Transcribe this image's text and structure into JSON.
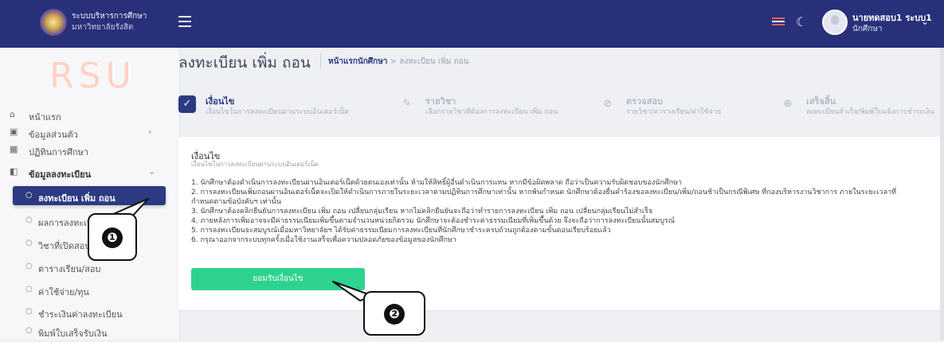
{
  "topbar": {
    "brand_line1": "ระบบบริหารการศึกษา",
    "brand_line2": "มหาวิทยาลัยรังสิต",
    "user_name": "นายทดสอบ1 ระบบ1",
    "user_role": "นักศึกษา"
  },
  "sidebar": {
    "logo_text": "RSU",
    "items": [
      {
        "label": "หน้าแรก",
        "icon": "home-icon"
      },
      {
        "label": "ข้อมูลส่วนตัว",
        "icon": "id-card-icon"
      },
      {
        "label": "ปฏิทินการศึกษา",
        "icon": "calendar-icon"
      },
      {
        "label": "ข้อมูลลงทะเบียน",
        "icon": "register-icon"
      }
    ],
    "sub_items": [
      {
        "label": "ลงทะเบียน เพิ่ม ถอน"
      },
      {
        "label": "ผลการลงทะเบียน"
      },
      {
        "label": "วิชาที่เปิดสอน"
      },
      {
        "label": "ตารางเรียน/สอบ"
      },
      {
        "label": "ค่าใช้จ่าย/ทุน"
      },
      {
        "label": "ชำระเงินค่าลงทะเบียน"
      },
      {
        "label": "พิมพ์ใบเสร็จรับเงิน"
      }
    ]
  },
  "header": {
    "page_title": "ลงทะเบียน เพิ่ม ถอน",
    "breadcrumb_home": "หน้าแรกนักศึกษา",
    "breadcrumb_sep": ">",
    "breadcrumb_current": "ลงทะเบียน เพิ่ม ถอน"
  },
  "steps": [
    {
      "title": "เงื่อนไข",
      "subtitle": "เงื่อนไขในการลงทะเบียนผ่านระบบอินเตอร์เน็ต",
      "icon": "check-icon",
      "active": true
    },
    {
      "title": "รายวิชา",
      "subtitle": "เลือกรายวิชาที่ต้องการลงทะเบียน เพิ่ม ถอน",
      "icon": "edit-icon",
      "active": false
    },
    {
      "title": "ตรวจสอบ",
      "subtitle": "รายวิชา/ตารางเรียน/ค่าใช้จ่าย",
      "icon": "check-circle-icon",
      "active": false
    },
    {
      "title": "เสร็จสิ้น",
      "subtitle": "ลงทะเบียนสำเร็จ/พิมพ์ใบแจ้งการชำระเงิน",
      "icon": "globe-icon",
      "active": false
    }
  ],
  "card": {
    "title": "เงื่อนไข",
    "subtitle": "เงื่อนไขในการลงทะเบียนผ่านระบบอินเตอร์เน็ต",
    "lines": [
      "1. นักศึกษาต้องดำเนินการลงทะเบียนผ่านอินเตอร์เน็ตด้วยตนเองเท่านั้น ห้ามให้สิทธิ์ผู้อื่นดำเนินการแทน หากมีข้อผิดพลาด ถือว่าเป็นความรับผิดชอบของนักศึกษา",
      "2. การลงทะเบียนเพิ่มถอนผ่านอินเตอร์เน็ตจะเปิดให้ดำเนินการภายในระยะเวลาตามปฏิทินการศึกษาเท่านั้น หากพ้นกำหนด นักศึกษาต้องยื่นคำร้องขอลงทะเบียน/เพิ่ม/ถอนช้าเป็นกรณีพิเศษ ที่กองบริหารงานวิชาการ ภายในระยะเวลาที่",
      "กำหนดตามข้อบังคับฯ เท่านั้น",
      "3. นักศึกษาต้องคลิกยืนยันการลงทะเบียน เพิ่ม ถอน เปลี่ยนกลุ่มเรียน หากไม่คลิกยืนยันจะถือว่าทำรายการลงทะเบียน เพิ่ม ถอน เปลี่ยนกลุ่มเรียนไม่สำเร็จ",
      "4. ภายหลังการเพิ่มอาจจะมีค่าธรรมเนียมเพิ่มขึ้นตามจำนวนหน่วยกิตรวม นักศึกษาจะต้องชำระค่าธรรมเนียมที่เพิ่มขึ้นด้วย จึงจะถือว่าการลงทะเบียนนั้นสมบูรณ์",
      "5. การลงทะเบียนจะสมบูรณ์เมื่อมหาวิทยาลัยฯ ได้รับค่าธรรมเนียมการลงทะเบียนที่นักศึกษาชำระครบถ้วนถูกต้องตามขั้นตอนเรียบร้อยแล้ว",
      "6. กรุณาออกจากระบบทุกครั้งเมื่อใช้งานเสร็จเพื่อความปลอดภัยของข้อมูลของนักศึกษา"
    ],
    "accept_label": "ยอมรับเงื่อนไข"
  },
  "callouts": [
    "❶",
    "❷"
  ],
  "colors": {
    "topbar": "#28307a",
    "active": "#2c3a82",
    "accept": "#2ed28f"
  }
}
